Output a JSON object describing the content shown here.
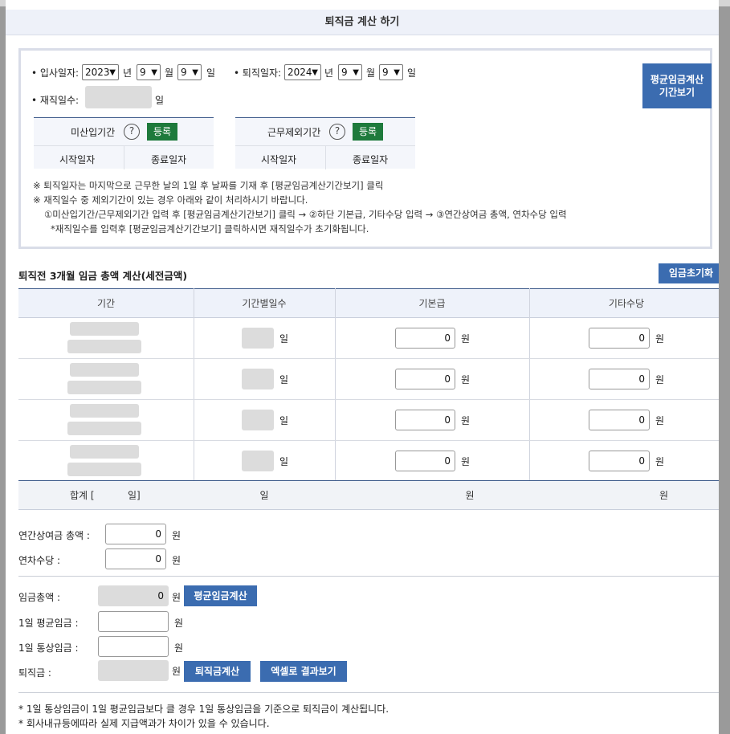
{
  "title": "퇴직금 계산 하기",
  "dates": {
    "hire_label": "• 입사일자:",
    "hire_year": "2023",
    "hire_month": "9",
    "hire_day": "9",
    "retire_label": "• 퇴직일자:",
    "retire_year": "2024",
    "retire_month": "9",
    "retire_day": "9",
    "year_unit": "년",
    "month_unit": "월",
    "day_unit": "일",
    "tenure_label": "• 재직일수:",
    "tenure_unit": "일"
  },
  "avg_period_button": "평균임금계산\n기간보기",
  "unpaid_period": {
    "label": "미산입기간",
    "help": "?",
    "register": "등록",
    "start": "시작일자",
    "end": "종료일자"
  },
  "excluded_period": {
    "label": "근무제외기간",
    "help": "?",
    "register": "등록",
    "start": "시작일자",
    "end": "종료일자"
  },
  "notes": [
    "※ 퇴직일자는 마지막으로 근무한 날의 1일 후 날짜를 기재 후 [평균임금계산기간보기] 클릭",
    "※ 재직일수 중 제외기간이 있는 경우 아래와 같이 처리하시기 바랍니다.",
    "①미산입기간/근무제외기간 입력 후 [평균임금계산기간보기] 클릭 → ②하단 기본급, 기타수당 입력 → ③연간상여금 총액, 연차수당 입력",
    "*재직일수를 입력후 [평균임금계산기간보기] 클릭하시면 재직일수가 초기화됩니다."
  ],
  "wage_section": {
    "title": "퇴직전 3개월 임금 총액 계산(세전금액)",
    "reset_button": "임금초기화",
    "columns": [
      "기간",
      "기간별일수",
      "기본급",
      "기타수당"
    ],
    "rows": [
      {
        "days_unit": "일",
        "base": "0",
        "base_unit": "원",
        "other": "0",
        "other_unit": "원"
      },
      {
        "days_unit": "일",
        "base": "0",
        "base_unit": "원",
        "other": "0",
        "other_unit": "원"
      },
      {
        "days_unit": "일",
        "base": "0",
        "base_unit": "원",
        "other": "0",
        "other_unit": "원"
      },
      {
        "days_unit": "일",
        "base": "0",
        "base_unit": "원",
        "other": "0",
        "other_unit": "원"
      }
    ],
    "footer": {
      "total_label_open": "합계 [",
      "total_label_close": "일]",
      "days": "일",
      "base": "원",
      "other": "원"
    }
  },
  "bonus": {
    "annual_label": "연간상여금 총액 :",
    "annual_value": "0",
    "annual_unit": "원",
    "leave_label": "연차수당 :",
    "leave_value": "0",
    "leave_unit": "원"
  },
  "results": {
    "total_label": "임금총액 :",
    "total_value": "0",
    "total_unit": "원",
    "avg_button": "평균임금계산",
    "daily_avg_label": "1일 평균임금 :",
    "daily_avg_unit": "원",
    "daily_ord_label": "1일 통상임금 :",
    "daily_ord_unit": "원",
    "severance_label": "퇴직금 :",
    "severance_unit": "원",
    "severance_button": "퇴직금계산",
    "excel_button": "엑셀로 결과보기"
  },
  "footnotes": [
    "* 1일 통상임금이 1일 평균임금보다 클 경우 1일 통상임금을 기준으로 퇴직금이 계산됩니다.",
    "* 회사내규등에따라 실제 지급액과가 차이가 있을 수 있습니다."
  ]
}
